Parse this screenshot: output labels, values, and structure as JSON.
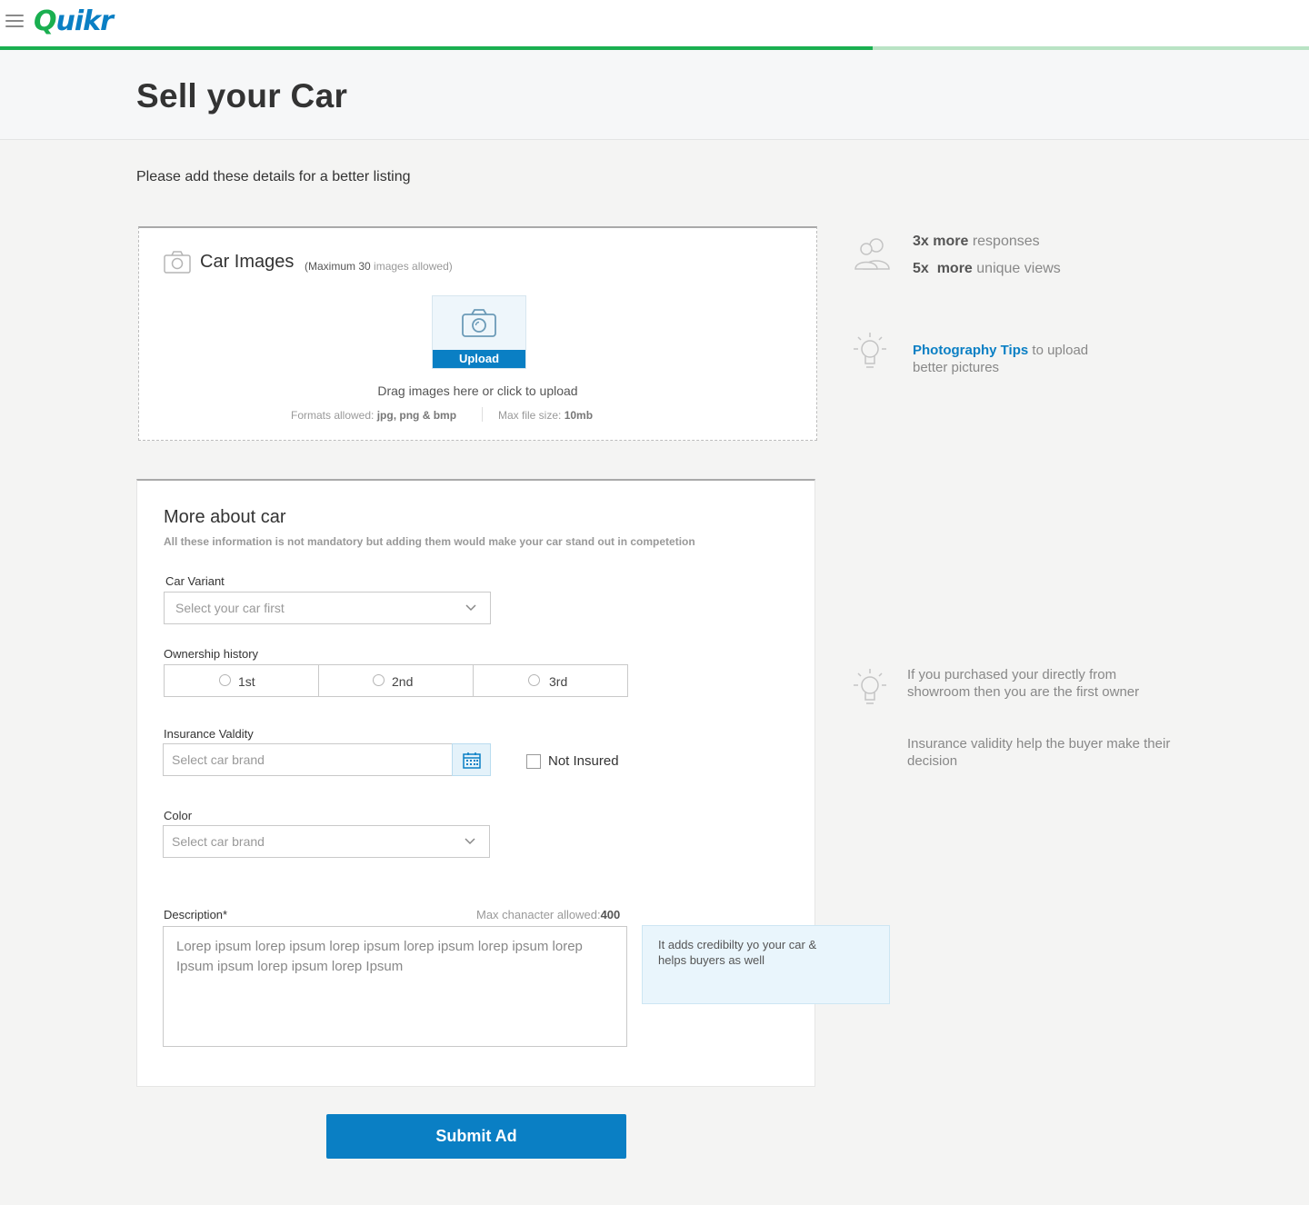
{
  "header": {
    "logo_q": "Q",
    "logo_rest": "uikr",
    "progress_fraction": 0.667
  },
  "page": {
    "title": "Sell your Car",
    "subheading": "Please add these details for a better listing"
  },
  "upload": {
    "title": "Car Images",
    "note_prefix": "(Maximum 30",
    "note_suffix": "images allowed)",
    "button_label": "Upload",
    "drag_text": "Drag images here or click to upload",
    "formats_label": "Formats allowed:",
    "formats_value": "jpg, png & bmp",
    "maxsize_label": "Max file size:",
    "maxsize_value": "10mb"
  },
  "tips": {
    "responses_bold": "3x more",
    "responses_rest": "responses",
    "views_bold": "5x",
    "views_mid": "more",
    "views_rest": "unique views",
    "photo_link": "Photography Tips",
    "photo_rest": "to upload",
    "photo_line2": "better pictures",
    "owner_tip": "If you purchased your directly from showroom then you are the first owner",
    "insurance_tip": "Insurance validity help the buyer make their decision"
  },
  "form": {
    "title": "More about car",
    "subtitle": "All these information is not mandatory but adding them would  make your car stand out in competetion",
    "variant_label": "Car Variant",
    "variant_placeholder": "Select your car first",
    "ownership_label": "Ownership history",
    "ownership_options": [
      "1st",
      "2nd",
      "3rd"
    ],
    "insurance_label": "Insurance Valdity",
    "insurance_placeholder": "Select car brand",
    "not_insured_label": "Not Insured",
    "color_label": "Color",
    "color_placeholder": "Select car brand",
    "description_label": "Description*",
    "description_max_label": "Max chanacter allowed:",
    "description_max_value": "400",
    "description_text": "Lorep ipsum lorep ipsum lorep ipsum lorep ipsum lorep ipsum lorep Ipsum ipsum lorep ipsum lorep Ipsum",
    "help_text": "It adds credibilty yo your car & helps buyers as well"
  },
  "actions": {
    "submit_label": "Submit Ad"
  },
  "colors": {
    "brand_green": "#1aaf50",
    "brand_blue": "#0a7fc4"
  }
}
